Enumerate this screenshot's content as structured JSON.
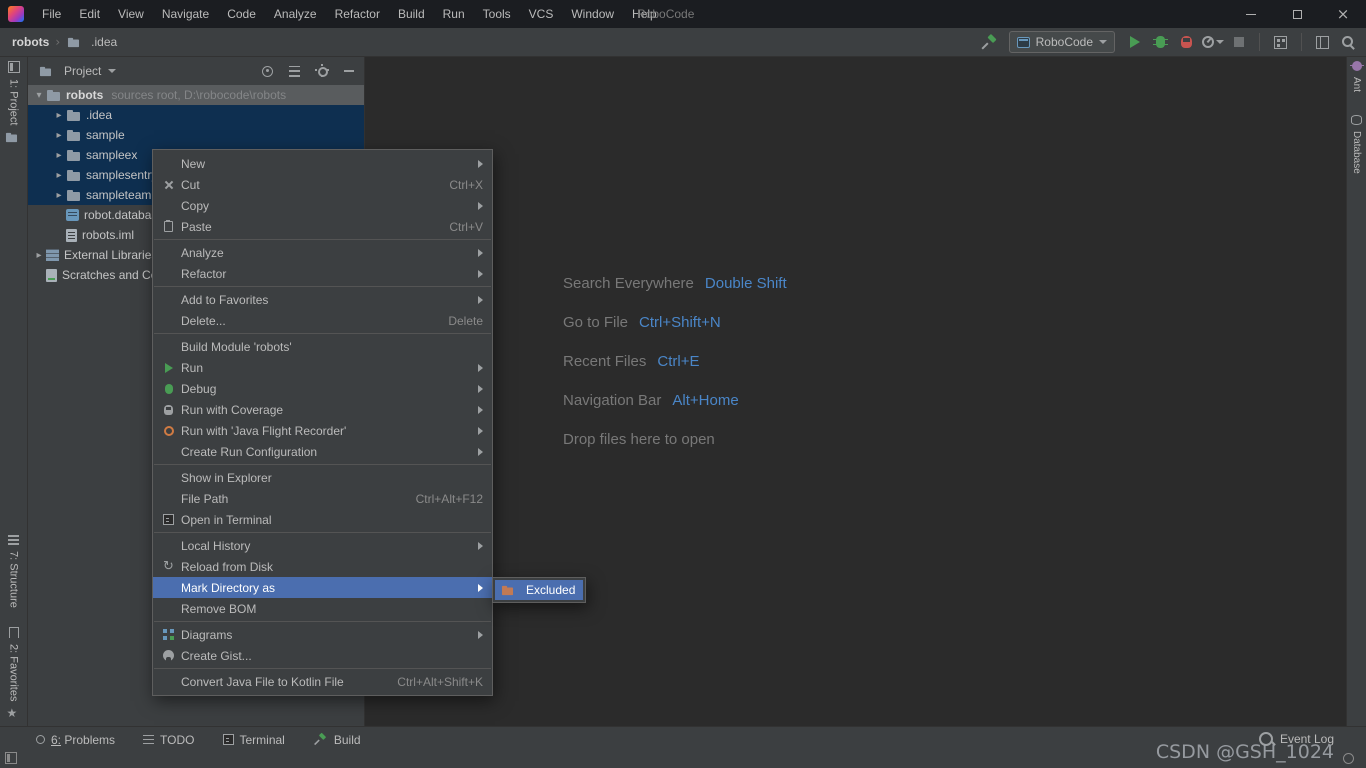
{
  "window": {
    "title": "RoboCode"
  },
  "menubar": {
    "items": [
      "File",
      "Edit",
      "View",
      "Navigate",
      "Code",
      "Analyze",
      "Refactor",
      "Build",
      "Run",
      "Tools",
      "VCS",
      "Window",
      "Help"
    ]
  },
  "toolbar": {
    "breadcrumb": {
      "root": "robots",
      "child": ".idea"
    },
    "run_config": "RoboCode"
  },
  "left_strip": {
    "project_tab": "1: Project",
    "structure_tab": "7: Structure",
    "favorites_tab": "2: Favorites"
  },
  "right_strip": {
    "ant_tab": "Ant",
    "database_tab": "Database"
  },
  "project_panel": {
    "header": "Project",
    "tree": {
      "root_label": "robots",
      "root_suffix": "sources root, D:\\robocode\\robots",
      "items": [
        {
          "label": ".idea"
        },
        {
          "label": "sample"
        },
        {
          "label": "sampleex"
        },
        {
          "label": "samplesentry"
        },
        {
          "label": "sampleteam"
        },
        {
          "label": "robot.database"
        },
        {
          "label": "robots.iml"
        },
        {
          "label": "External Libraries"
        },
        {
          "label": "Scratches and Consoles"
        }
      ]
    }
  },
  "context_menu": {
    "items": [
      {
        "label": "New"
      },
      {
        "label": "Cut",
        "shortcut": "Ctrl+X"
      },
      {
        "label": "Copy"
      },
      {
        "label": "Paste",
        "shortcut": "Ctrl+V"
      },
      {
        "label": "Analyze"
      },
      {
        "label": "Refactor"
      },
      {
        "label": "Add to Favorites"
      },
      {
        "label": "Delete...",
        "shortcut": "Delete"
      },
      {
        "label": "Build Module 'robots'"
      },
      {
        "label": "Run"
      },
      {
        "label": "Debug"
      },
      {
        "label": "Run with Coverage"
      },
      {
        "label": "Run with 'Java Flight Recorder'"
      },
      {
        "label": "Create Run Configuration"
      },
      {
        "label": "Show in Explorer"
      },
      {
        "label": "File Path",
        "shortcut": "Ctrl+Alt+F12"
      },
      {
        "label": "Open in Terminal"
      },
      {
        "label": "Local History"
      },
      {
        "label": "Reload from Disk"
      },
      {
        "label": "Mark Directory as"
      },
      {
        "label": "Remove BOM"
      },
      {
        "label": "Diagrams"
      },
      {
        "label": "Create Gist..."
      },
      {
        "label": "Convert Java File to Kotlin File",
        "shortcut": "Ctrl+Alt+Shift+K"
      }
    ],
    "submenu": {
      "label": "Excluded"
    }
  },
  "editor": {
    "hints": [
      {
        "label": "Search Everywhere",
        "shortcut": "Double Shift"
      },
      {
        "label": "Go to File",
        "shortcut": "Ctrl+Shift+N"
      },
      {
        "label": "Recent Files",
        "shortcut": "Ctrl+E"
      },
      {
        "label": "Navigation Bar",
        "shortcut": "Alt+Home"
      },
      {
        "label": "Drop files here to open",
        "shortcut": ""
      }
    ]
  },
  "statusbar": {
    "items": [
      "6: Problems",
      "TODO",
      "Terminal",
      "Build"
    ],
    "event_log": "Event Log"
  },
  "watermark": "CSDN @GSH_1024",
  "icons": {
    "run": "green-triangle",
    "debug": "green-bug",
    "coverage": "shield",
    "flight_recorder": "orange-ring",
    "reload": "circular-arrow",
    "cut": "scissors",
    "paste": "clipboard",
    "terminal": "terminal-box",
    "diagrams": "grid-squares",
    "gist": "github-circle",
    "excluded_folder": "orange-folder",
    "search": "magnifier",
    "build": "hammer"
  },
  "colors": {
    "menu_selection": "#4b6eaf",
    "tree_selection": "#0e2f50",
    "accent_green": "#499c54",
    "link_blue": "#4a86c8",
    "panel_bg": "#3c3f41",
    "editor_bg": "#2b2b2b",
    "titlebar_bg": "#1b1d21"
  }
}
